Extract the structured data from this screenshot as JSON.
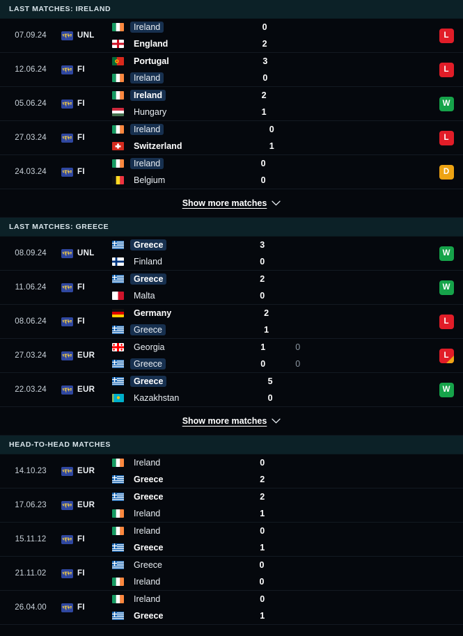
{
  "colors": {
    "background": "#05080d",
    "section_header_bg": "#0c2127",
    "highlight_pill": "#17304f",
    "win": "#16a34a",
    "loss": "#e11d28",
    "draw": "#eda313",
    "penalty_corner": "#f0a516"
  },
  "sections": [
    {
      "id": "last-matches-ireland",
      "title": "LAST MATCHES: IRELAND",
      "show_more_label": "Show more matches",
      "has_show_more": true,
      "matches": [
        {
          "date": "07.09.24",
          "competition": "UNL",
          "home": {
            "team": "Ireland",
            "flag": "ireland",
            "score": "0",
            "alt_score": "",
            "bold": false,
            "highlight": true
          },
          "away": {
            "team": "England",
            "flag": "england",
            "score": "2",
            "alt_score": "",
            "bold": true,
            "highlight": false
          },
          "result": "L",
          "penalty": false
        },
        {
          "date": "12.06.24",
          "competition": "FI",
          "home": {
            "team": "Portugal",
            "flag": "portugal",
            "score": "3",
            "alt_score": "",
            "bold": true,
            "highlight": false
          },
          "away": {
            "team": "Ireland",
            "flag": "ireland",
            "score": "0",
            "alt_score": "",
            "bold": false,
            "highlight": true
          },
          "result": "L",
          "penalty": false
        },
        {
          "date": "05.06.24",
          "competition": "FI",
          "home": {
            "team": "Ireland",
            "flag": "ireland",
            "score": "2",
            "alt_score": "",
            "bold": true,
            "highlight": true
          },
          "away": {
            "team": "Hungary",
            "flag": "hungary",
            "score": "1",
            "alt_score": "",
            "bold": false,
            "highlight": false
          },
          "result": "W",
          "penalty": false
        },
        {
          "date": "27.03.24",
          "competition": "FI",
          "home": {
            "team": "Ireland",
            "flag": "ireland",
            "score": "0",
            "alt_score": "",
            "bold": false,
            "highlight": true
          },
          "away": {
            "team": "Switzerland",
            "flag": "switzerland",
            "score": "1",
            "alt_score": "",
            "bold": true,
            "highlight": false
          },
          "result": "L",
          "penalty": false
        },
        {
          "date": "24.03.24",
          "competition": "FI",
          "home": {
            "team": "Ireland",
            "flag": "ireland",
            "score": "0",
            "alt_score": "",
            "bold": false,
            "highlight": true
          },
          "away": {
            "team": "Belgium",
            "flag": "belgium",
            "score": "0",
            "alt_score": "",
            "bold": false,
            "highlight": false
          },
          "result": "D",
          "penalty": false
        }
      ]
    },
    {
      "id": "last-matches-greece",
      "title": "LAST MATCHES: GREECE",
      "show_more_label": "Show more matches",
      "has_show_more": true,
      "matches": [
        {
          "date": "08.09.24",
          "competition": "UNL",
          "home": {
            "team": "Greece",
            "flag": "greece",
            "score": "3",
            "alt_score": "",
            "bold": true,
            "highlight": true
          },
          "away": {
            "team": "Finland",
            "flag": "finland",
            "score": "0",
            "alt_score": "",
            "bold": false,
            "highlight": false
          },
          "result": "W",
          "penalty": false
        },
        {
          "date": "11.06.24",
          "competition": "FI",
          "home": {
            "team": "Greece",
            "flag": "greece",
            "score": "2",
            "alt_score": "",
            "bold": true,
            "highlight": true
          },
          "away": {
            "team": "Malta",
            "flag": "malta",
            "score": "0",
            "alt_score": "",
            "bold": false,
            "highlight": false
          },
          "result": "W",
          "penalty": false
        },
        {
          "date": "08.06.24",
          "competition": "FI",
          "home": {
            "team": "Germany",
            "flag": "germany",
            "score": "2",
            "alt_score": "",
            "bold": true,
            "highlight": false
          },
          "away": {
            "team": "Greece",
            "flag": "greece",
            "score": "1",
            "alt_score": "",
            "bold": false,
            "highlight": true
          },
          "result": "L",
          "penalty": false
        },
        {
          "date": "27.03.24",
          "competition": "EUR",
          "home": {
            "team": "Georgia",
            "flag": "georgia",
            "score": "1",
            "alt_score": "0",
            "bold": false,
            "highlight": false
          },
          "away": {
            "team": "Greece",
            "flag": "greece",
            "score": "0",
            "alt_score": "0",
            "bold": false,
            "highlight": true
          },
          "result": "L",
          "penalty": true
        },
        {
          "date": "22.03.24",
          "competition": "EUR",
          "home": {
            "team": "Greece",
            "flag": "greece",
            "score": "5",
            "alt_score": "",
            "bold": true,
            "highlight": true
          },
          "away": {
            "team": "Kazakhstan",
            "flag": "kazakhstan",
            "score": "0",
            "alt_score": "",
            "bold": false,
            "highlight": false
          },
          "result": "W",
          "penalty": false
        }
      ]
    },
    {
      "id": "head-to-head-matches",
      "title": "HEAD-TO-HEAD MATCHES",
      "show_more_label": "",
      "has_show_more": false,
      "matches": [
        {
          "date": "14.10.23",
          "competition": "EUR",
          "home": {
            "team": "Ireland",
            "flag": "ireland",
            "score": "0",
            "alt_score": "",
            "bold": false,
            "highlight": false
          },
          "away": {
            "team": "Greece",
            "flag": "greece",
            "score": "2",
            "alt_score": "",
            "bold": true,
            "highlight": false
          },
          "result": "",
          "penalty": false
        },
        {
          "date": "17.06.23",
          "competition": "EUR",
          "home": {
            "team": "Greece",
            "flag": "greece",
            "score": "2",
            "alt_score": "",
            "bold": true,
            "highlight": false
          },
          "away": {
            "team": "Ireland",
            "flag": "ireland",
            "score": "1",
            "alt_score": "",
            "bold": false,
            "highlight": false
          },
          "result": "",
          "penalty": false
        },
        {
          "date": "15.11.12",
          "competition": "FI",
          "home": {
            "team": "Ireland",
            "flag": "ireland",
            "score": "0",
            "alt_score": "",
            "bold": false,
            "highlight": false
          },
          "away": {
            "team": "Greece",
            "flag": "greece",
            "score": "1",
            "alt_score": "",
            "bold": true,
            "highlight": false
          },
          "result": "",
          "penalty": false
        },
        {
          "date": "21.11.02",
          "competition": "FI",
          "home": {
            "team": "Greece",
            "flag": "greece",
            "score": "0",
            "alt_score": "",
            "bold": false,
            "highlight": false
          },
          "away": {
            "team": "Ireland",
            "flag": "ireland",
            "score": "0",
            "alt_score": "",
            "bold": false,
            "highlight": false
          },
          "result": "",
          "penalty": false
        },
        {
          "date": "26.04.00",
          "competition": "FI",
          "home": {
            "team": "Ireland",
            "flag": "ireland",
            "score": "0",
            "alt_score": "",
            "bold": false,
            "highlight": false
          },
          "away": {
            "team": "Greece",
            "flag": "greece",
            "score": "1",
            "alt_score": "",
            "bold": true,
            "highlight": false
          },
          "result": "",
          "penalty": false
        }
      ]
    }
  ]
}
